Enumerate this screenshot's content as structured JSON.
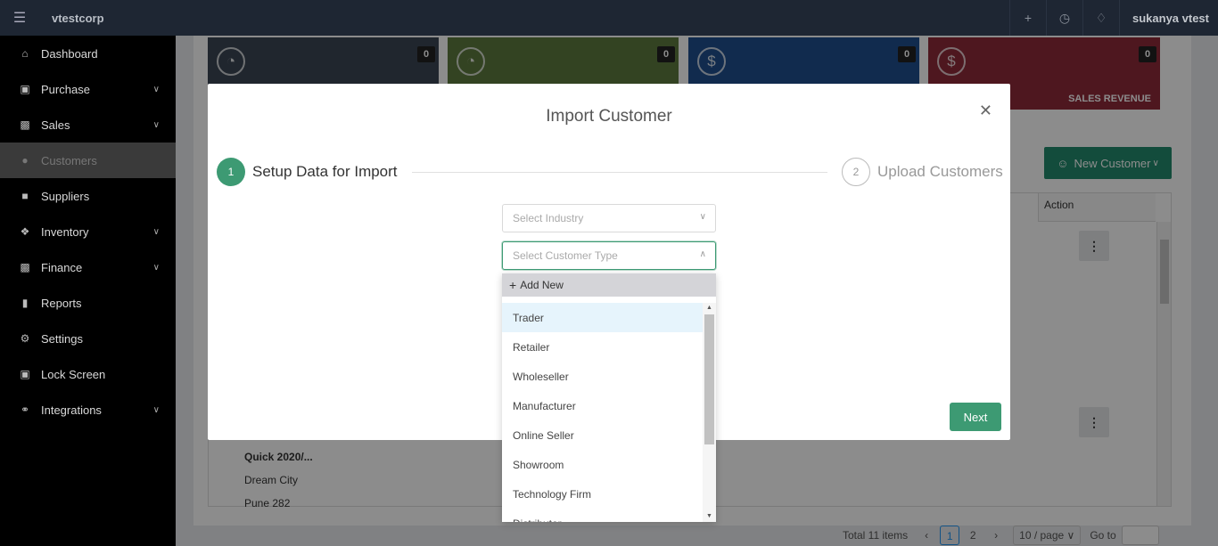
{
  "topbar": {
    "brand": "vtestcorp",
    "user": "sukanya vtest",
    "icons": [
      "menu-icon",
      "plus-icon",
      "clock-icon",
      "bell-icon"
    ]
  },
  "sidebar": {
    "items": [
      {
        "label": "Dashboard",
        "icon": "home-icon",
        "has_chevron": false
      },
      {
        "label": "Purchase",
        "icon": "cart-icon",
        "has_chevron": true
      },
      {
        "label": "Sales",
        "icon": "money-icon",
        "has_chevron": true
      },
      {
        "label": "Customers",
        "icon": "user-icon",
        "has_chevron": false,
        "active": true
      },
      {
        "label": "Suppliers",
        "icon": "truck-icon",
        "has_chevron": false
      },
      {
        "label": "Inventory",
        "icon": "boxes-icon",
        "has_chevron": true
      },
      {
        "label": "Finance",
        "icon": "finance-icon",
        "has_chevron": true
      },
      {
        "label": "Reports",
        "icon": "bar-chart-icon",
        "has_chevron": false
      },
      {
        "label": "Settings",
        "icon": "gears-icon",
        "has_chevron": false
      },
      {
        "label": "Lock Screen",
        "icon": "lock-icon",
        "has_chevron": false
      },
      {
        "label": "Integrations",
        "icon": "plug-icon",
        "has_chevron": true
      }
    ]
  },
  "cards": [
    {
      "count": "0",
      "label": "",
      "color": "#3b4654",
      "icon": "gauge-icon"
    },
    {
      "count": "0",
      "label": "",
      "color": "#5d7a3f",
      "icon": "gauge-icon"
    },
    {
      "count": "0",
      "label": "",
      "color": "#1f4f8f",
      "icon": "dollar-icon"
    },
    {
      "count": "0",
      "label": "SALES REVENUE",
      "color": "#8f2a3a",
      "icon": "dollar-icon"
    }
  ],
  "page": {
    "new_customer_label": "New Customer",
    "table_action_header": "Action",
    "row_name": "Quick 2020/...",
    "row_city": "Dream City",
    "row_pin": "Pune 282"
  },
  "pagination": {
    "total": "Total 11 items",
    "pages": [
      "1",
      "2"
    ],
    "current": "1",
    "page_size": "10 / page",
    "goto": "Go to"
  },
  "modal": {
    "title": "Import Customer",
    "step1": {
      "num": "1",
      "label": "Setup Data for Import"
    },
    "step2": {
      "num": "2",
      "label": "Upload Customers"
    },
    "industry_placeholder": "Select Industry",
    "customer_type_placeholder": "Select Customer Type",
    "next_label": "Next"
  },
  "dropdown": {
    "add_new": "Add New",
    "options": [
      "Trader",
      "Retailer",
      "Wholeseller",
      "Manufacturer",
      "Online Seller",
      "Showroom",
      "Technology Firm",
      "Distributor"
    ],
    "hovered_index": 0
  },
  "colors": {
    "accent": "#3d9a73",
    "topbar": "#1e2633",
    "sidebar": "#000000"
  }
}
